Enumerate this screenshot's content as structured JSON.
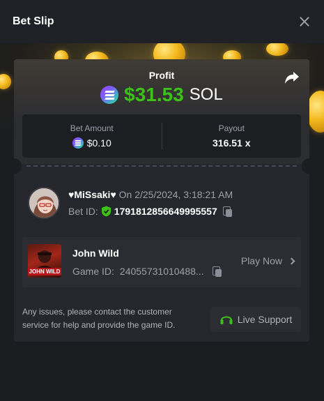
{
  "header": {
    "title": "Bet Slip",
    "close_icon": "close-icon"
  },
  "profit": {
    "label": "Profit",
    "amount": "$31.53",
    "currency": "SOL",
    "amount_color": "#3bc117"
  },
  "stats": {
    "bet_amount_label": "Bet Amount",
    "bet_amount_value": "$0.10",
    "payout_label": "Payout",
    "payout_value": "316.51 x"
  },
  "user": {
    "name": "♥MiSsaki♥",
    "date_text": "On 2/25/2024, 3:18:21 AM",
    "bet_id_label": "Bet ID:",
    "bet_id": "1791812856649995557"
  },
  "game": {
    "name": "John Wild",
    "id_label": "Game ID:",
    "id_value": "24055731010488...",
    "thumb_text": "JOHN WILD",
    "play_label": "Play Now"
  },
  "footer": {
    "help_text": "Any issues, please contact the customer service for help and provide the game ID.",
    "support_label": "Live Support",
    "support_icon_color": "#3bc117"
  }
}
